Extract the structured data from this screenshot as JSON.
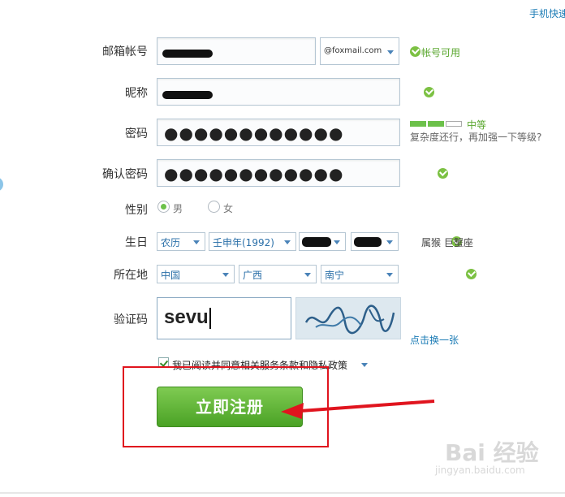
{
  "header": {
    "top_link": "手机快速"
  },
  "form": {
    "email": {
      "label": "邮箱帐号",
      "domain": "@foxmail.com",
      "status": "帐号可用"
    },
    "nickname": {
      "label": "昵称"
    },
    "password": {
      "label": "密码",
      "value": "●●●●●●●●●●●●",
      "strength": "中等",
      "strength_hint": "复杂度还行，再加强一下等级?"
    },
    "confirm_password": {
      "label": "确认密码",
      "value": "●●●●●●●●●●●●"
    },
    "gender": {
      "label": "性别",
      "options": [
        "男",
        "女"
      ],
      "selected": "男"
    },
    "birthday": {
      "label": "生日",
      "calendar": "农历",
      "year": "壬申年(1992)",
      "zodiac": "属猴  巨蟹座"
    },
    "location": {
      "label": "所在地",
      "country": "中国",
      "province": "广西",
      "city": "南宁"
    },
    "captcha": {
      "label": "验证码",
      "value": "sevu",
      "refresh_link": "点击换一张"
    },
    "agreement": {
      "text": "我已阅读并同意相关服务条款和隐私政策",
      "checked": true
    },
    "submit_label": "立即注册"
  },
  "watermark": {
    "logo": "Bai 经验",
    "sub": "jingyan.baidu.com"
  },
  "colors": {
    "accent_green": "#58a62c",
    "button_green": "#4aa225",
    "link_blue": "#1a7bb5",
    "highlight_red": "#e0141e"
  }
}
